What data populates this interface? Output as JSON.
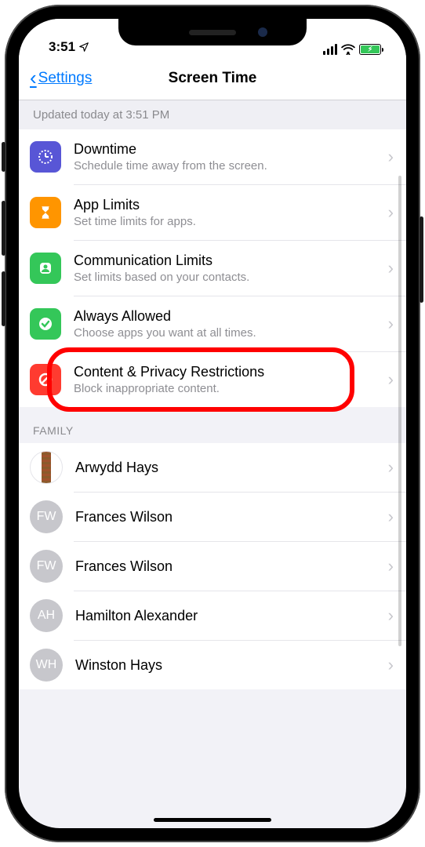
{
  "status": {
    "time": "3:51",
    "location_icon": "location"
  },
  "nav": {
    "back": "Settings",
    "title": "Screen Time"
  },
  "update_text": "Updated today at 3:51 PM",
  "options": [
    {
      "icon": "downtime",
      "color": "purple",
      "title": "Downtime",
      "sub": "Schedule time away from the screen."
    },
    {
      "icon": "hourglass",
      "color": "orange",
      "title": "App Limits",
      "sub": "Set time limits for apps."
    },
    {
      "icon": "person",
      "color": "green",
      "title": "Communication Limits",
      "sub": "Set limits based on your contacts."
    },
    {
      "icon": "check",
      "color": "green",
      "title": "Always Allowed",
      "sub": "Choose apps you want at all times."
    },
    {
      "icon": "nosign",
      "color": "red",
      "title": "Content & Privacy Restrictions",
      "sub": "Block inappropriate content.",
      "highlighted": true
    }
  ],
  "family_header": "FAMILY",
  "family": [
    {
      "name": "Arwydd Hays",
      "avatar_type": "image"
    },
    {
      "name": "Frances Wilson",
      "avatar_type": "initials",
      "initials": "FW"
    },
    {
      "name": "Frances Wilson",
      "avatar_type": "initials",
      "initials": "FW"
    },
    {
      "name": "Hamilton Alexander",
      "avatar_type": "initials",
      "initials": "AH"
    },
    {
      "name": "Winston Hays",
      "avatar_type": "initials",
      "initials": "WH"
    }
  ]
}
